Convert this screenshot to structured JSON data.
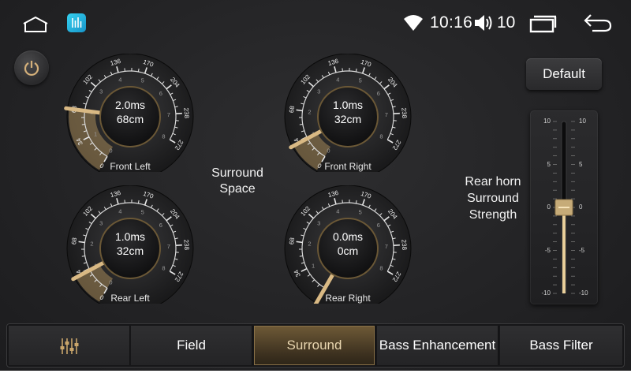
{
  "status_bar": {
    "time": "10:16",
    "volume": "10",
    "icons": [
      "home-icon",
      "equalizer-app-icon",
      "wifi-icon",
      "volume-icon",
      "recents-icon",
      "back-icon"
    ]
  },
  "colors": {
    "accent_gold": "#c9a56b",
    "background": "#252527",
    "active_tab": "#5b4a2e"
  },
  "knobs": [
    {
      "id": "front-left",
      "label": "Front Left",
      "delay": "2.0ms",
      "distance": "68cm",
      "pointer_value": 68
    },
    {
      "id": "front-right",
      "label": "Front Right",
      "delay": "1.0ms",
      "distance": "32cm",
      "pointer_value": 32
    },
    {
      "id": "rear-left",
      "label": "Rear Left",
      "delay": "1.0ms",
      "distance": "32cm",
      "pointer_value": 32
    },
    {
      "id": "rear-right",
      "label": "Rear Right",
      "delay": "0.0ms",
      "distance": "0cm",
      "pointer_value": 0
    }
  ],
  "knob_scale": {
    "outer_ticks": [
      "0",
      "34",
      "68",
      "102",
      "136",
      "170",
      "204",
      "238",
      "272"
    ],
    "inner_ticks": [
      "0",
      "1",
      "2",
      "3",
      "4",
      "5",
      "6",
      "7",
      "8"
    ]
  },
  "surround_space_label": "Surround Space",
  "default_button": "Default",
  "rear_horn_label": "Rear horn Surround Strength",
  "strength_slider": {
    "value": 0,
    "ticks": [
      "10",
      "5",
      "0",
      "-5",
      "-10"
    ]
  },
  "tabs": [
    {
      "label": "",
      "icon": "equalizer-icon",
      "active": false
    },
    {
      "label": "Field",
      "active": false
    },
    {
      "label": "Surround",
      "active": true
    },
    {
      "label": "Bass Enhancement",
      "active": false
    },
    {
      "label": "Bass Filter",
      "active": false
    }
  ]
}
